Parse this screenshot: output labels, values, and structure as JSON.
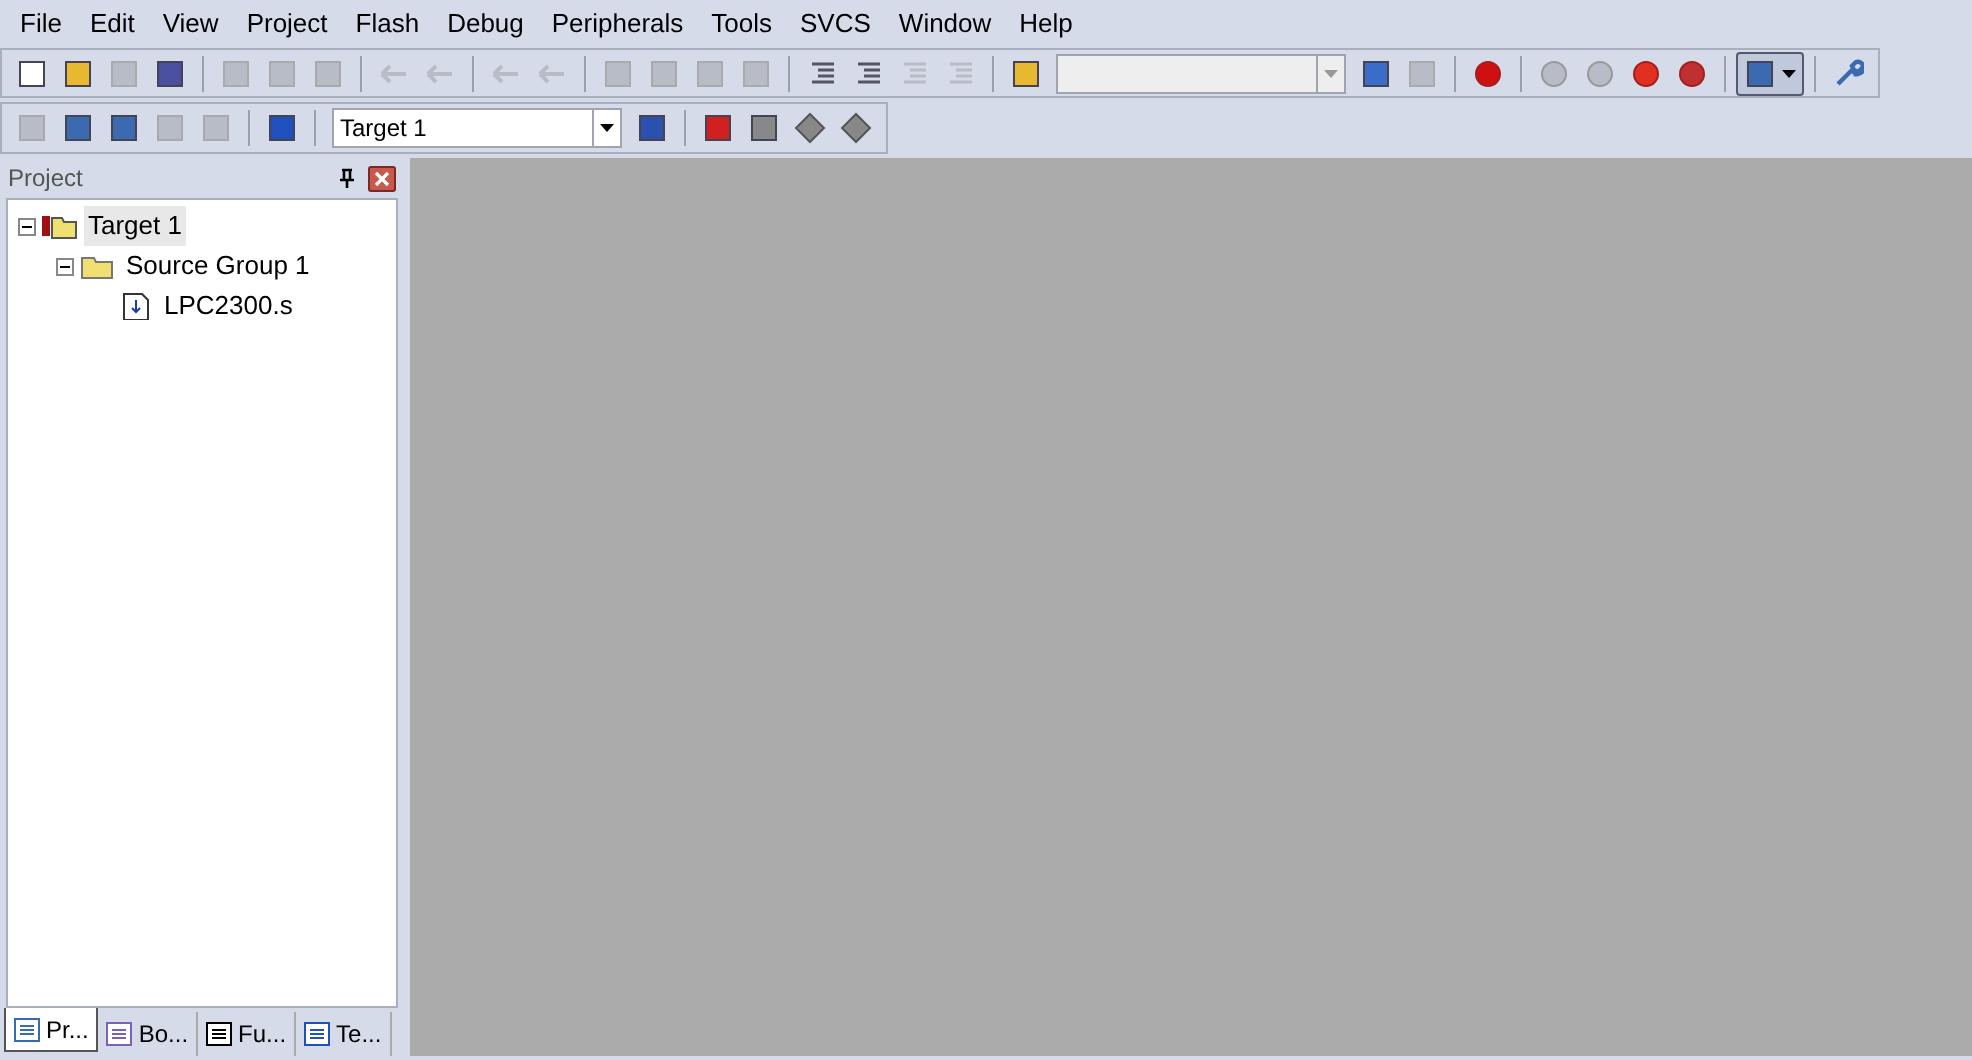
{
  "menu": [
    "File",
    "Edit",
    "View",
    "Project",
    "Flash",
    "Debug",
    "Peripherals",
    "Tools",
    "SVCS",
    "Window",
    "Help"
  ],
  "toolbar_1": [
    {
      "kind": "button",
      "disabled": false
    },
    {
      "kind": "button",
      "disabled": false
    },
    {
      "kind": "button",
      "disabled": true
    },
    {
      "kind": "button",
      "disabled": false
    },
    {
      "kind": "separator"
    },
    {
      "kind": "button",
      "disabled": true
    },
    {
      "kind": "button",
      "disabled": true
    },
    {
      "kind": "button",
      "disabled": true
    },
    {
      "kind": "separator"
    },
    {
      "kind": "button",
      "disabled": true
    },
    {
      "kind": "button",
      "disabled": true
    },
    {
      "kind": "separator"
    },
    {
      "kind": "button",
      "disabled": true
    },
    {
      "kind": "button",
      "disabled": true
    },
    {
      "kind": "separator"
    },
    {
      "kind": "button",
      "disabled": true
    },
    {
      "kind": "button",
      "disabled": true
    },
    {
      "kind": "button",
      "disabled": true
    },
    {
      "kind": "button",
      "disabled": true
    },
    {
      "kind": "separator"
    },
    {
      "kind": "button",
      "disabled": false
    },
    {
      "kind": "button",
      "disabled": false
    },
    {
      "kind": "button",
      "disabled": true
    },
    {
      "kind": "button",
      "disabled": true
    },
    {
      "kind": "separator"
    },
    {
      "kind": "button",
      "disabled": false
    },
    {
      "kind": "combo",
      "disabled": true
    },
    {
      "kind": "button",
      "disabled": false
    },
    {
      "kind": "button",
      "disabled": true
    },
    {
      "kind": "separator"
    },
    {
      "kind": "button",
      "disabled": false
    },
    {
      "kind": "separator"
    },
    {
      "kind": "button",
      "disabled": true
    },
    {
      "kind": "button",
      "disabled": true
    },
    {
      "kind": "button",
      "disabled": false
    },
    {
      "kind": "button",
      "disabled": false
    },
    {
      "kind": "separator"
    },
    {
      "kind": "dropdown",
      "selected": true
    },
    {
      "kind": "separator"
    },
    {
      "kind": "button",
      "disabled": false
    }
  ],
  "toolbar_2": [
    {
      "kind": "button",
      "disabled": true
    },
    {
      "kind": "button",
      "disabled": false
    },
    {
      "kind": "button",
      "disabled": false
    },
    {
      "kind": "button",
      "disabled": true
    },
    {
      "kind": "button",
      "disabled": true
    },
    {
      "kind": "separator"
    },
    {
      "kind": "button",
      "disabled": false
    },
    {
      "kind": "separator"
    },
    {
      "kind": "combo",
      "disabled": false,
      "value": "Target 1"
    },
    {
      "kind": "button",
      "disabled": false
    },
    {
      "kind": "separator"
    },
    {
      "kind": "button",
      "disabled": false
    },
    {
      "kind": "button",
      "disabled": false
    },
    {
      "kind": "button",
      "disabled": false
    },
    {
      "kind": "button",
      "disabled": false
    }
  ],
  "project_panel": {
    "title": "Project",
    "tree": [
      {
        "label": "Target 1",
        "kind": "target",
        "selected": true,
        "expanded": true,
        "children": [
          {
            "label": "Source Group 1",
            "kind": "group",
            "selected": false,
            "expanded": true,
            "children": [
              {
                "label": "LPC2300.s",
                "kind": "file",
                "selected": false
              }
            ]
          }
        ]
      }
    ],
    "tabs": [
      {
        "label": "Pr...",
        "selected": true
      },
      {
        "label": "Bo...",
        "selected": false
      },
      {
        "label": "Fu...",
        "selected": false
      },
      {
        "label": "Te...",
        "selected": false
      }
    ]
  }
}
